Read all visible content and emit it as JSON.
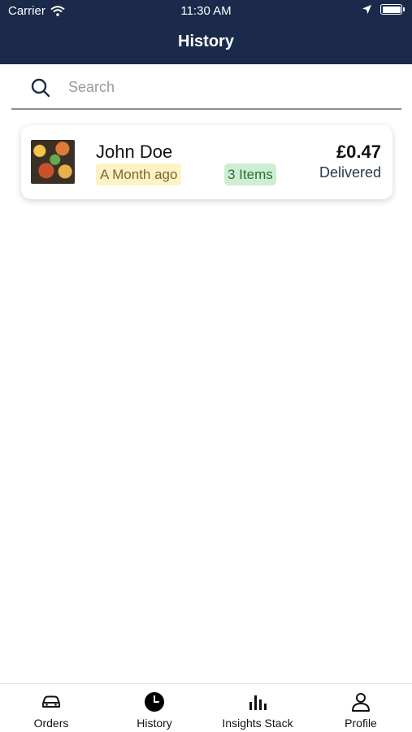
{
  "status_bar": {
    "carrier": "Carrier",
    "time": "11:30 AM"
  },
  "header": {
    "title": "History",
    "background": "#1b2a4a"
  },
  "search": {
    "placeholder": "Search",
    "value": ""
  },
  "orders": [
    {
      "customer": "John Doe",
      "time_ago": "A Month ago",
      "items": "3 Items",
      "price": "£0.47",
      "status": "Delivered",
      "thumbnail_icon": "food-platter-image"
    }
  ],
  "tabs": [
    {
      "label": "Orders",
      "icon": "car-icon"
    },
    {
      "label": "History",
      "icon": "clock-icon",
      "active": true
    },
    {
      "label": "Insights Stack",
      "icon": "bar-chart-icon"
    },
    {
      "label": "Profile",
      "icon": "person-icon"
    }
  ],
  "colors": {
    "time_badge_bg": "#fdf3c6",
    "items_badge_bg": "#cdeed3"
  }
}
